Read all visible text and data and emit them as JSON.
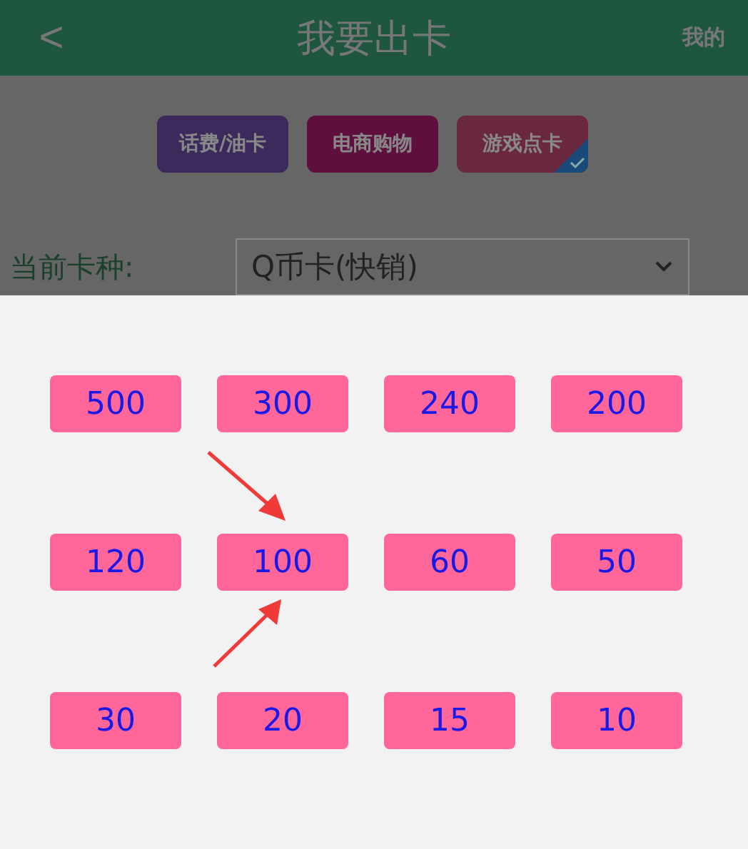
{
  "header": {
    "back": "<",
    "title": "我要出卡",
    "action": "我的"
  },
  "categories": [
    {
      "label": "话费/油卡",
      "color": "#3d2a5c",
      "selected": false
    },
    {
      "label": "电商购物",
      "color": "#5e0f3e",
      "selected": false
    },
    {
      "label": "游戏点卡",
      "color": "#6a2840",
      "selected": true
    }
  ],
  "card_type": {
    "label": "当前卡种:",
    "value": "Q币卡(快销)"
  },
  "amounts": [
    "500",
    "300",
    "240",
    "200",
    "120",
    "100",
    "60",
    "50",
    "30",
    "20",
    "15",
    "10"
  ]
}
